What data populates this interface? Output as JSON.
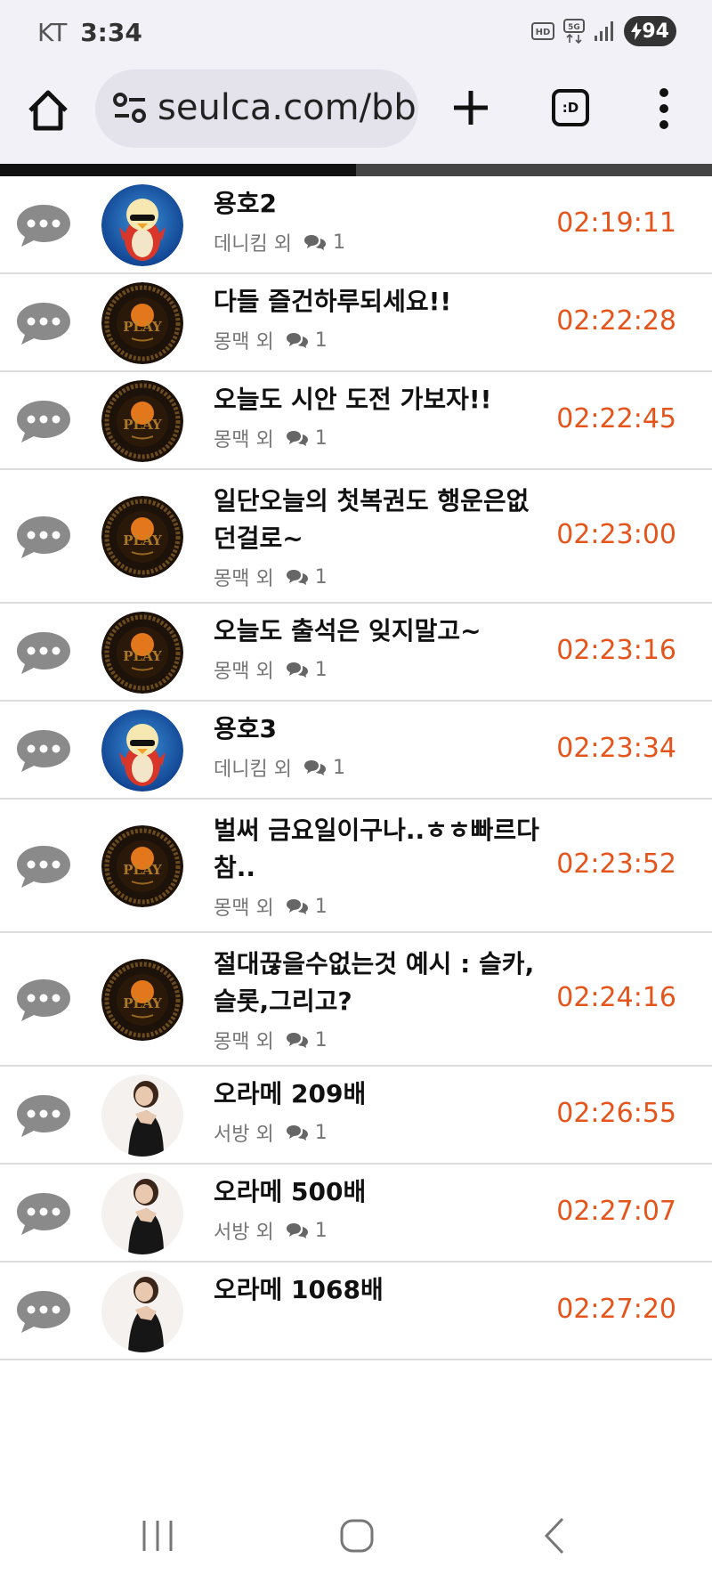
{
  "status_bar": {
    "carrier": "KT",
    "time": "3:34",
    "icons": [
      "hd-icon",
      "5g-icon",
      "signal-icon"
    ],
    "battery": "94"
  },
  "browser": {
    "url": "seulca.com/bbs",
    "tabs_label": ":D",
    "progress": 0.5
  },
  "rows": [
    {
      "title": "용호2",
      "author": "데니킴 외",
      "comments": "1",
      "time": "02:19:11",
      "avatar": "penguin"
    },
    {
      "title": "다들 즐건하루되세요!!",
      "author": "몽맥 외",
      "comments": "1",
      "time": "02:22:28",
      "avatar": "play"
    },
    {
      "title": "오늘도 시안 도전 가보자!!",
      "author": "몽맥 외",
      "comments": "1",
      "time": "02:22:45",
      "avatar": "play"
    },
    {
      "title": "일단오늘의 첫복권도 행운은없던걸로~",
      "author": "몽맥 외",
      "comments": "1",
      "time": "02:23:00",
      "avatar": "play"
    },
    {
      "title": "오늘도 출석은 잊지말고~",
      "author": "몽맥 외",
      "comments": "1",
      "time": "02:23:16",
      "avatar": "play"
    },
    {
      "title": "용호3",
      "author": "데니킴 외",
      "comments": "1",
      "time": "02:23:34",
      "avatar": "penguin"
    },
    {
      "title": "벌써 금요일이구나..ㅎㅎ빠르다참..",
      "author": "몽맥 외",
      "comments": "1",
      "time": "02:23:52",
      "avatar": "play"
    },
    {
      "title": "절대끊을수없는것 예시 : 슬카, 슬롯,그리고?",
      "author": "몽맥 외",
      "comments": "1",
      "time": "02:24:16",
      "avatar": "play"
    },
    {
      "title": "오라메 209배",
      "author": "서방 외",
      "comments": "1",
      "time": "02:26:55",
      "avatar": "woman"
    },
    {
      "title": "오라메 500배",
      "author": "서방 외",
      "comments": "1",
      "time": "02:27:07",
      "avatar": "woman"
    },
    {
      "title": "오라메 1068배",
      "author": "",
      "comments": "",
      "time": "02:27:20",
      "avatar": "woman"
    }
  ],
  "colors": {
    "time": "#e5541b",
    "chrome_bg": "#f2f1f8",
    "icon_gray": "#8a8a8a"
  }
}
